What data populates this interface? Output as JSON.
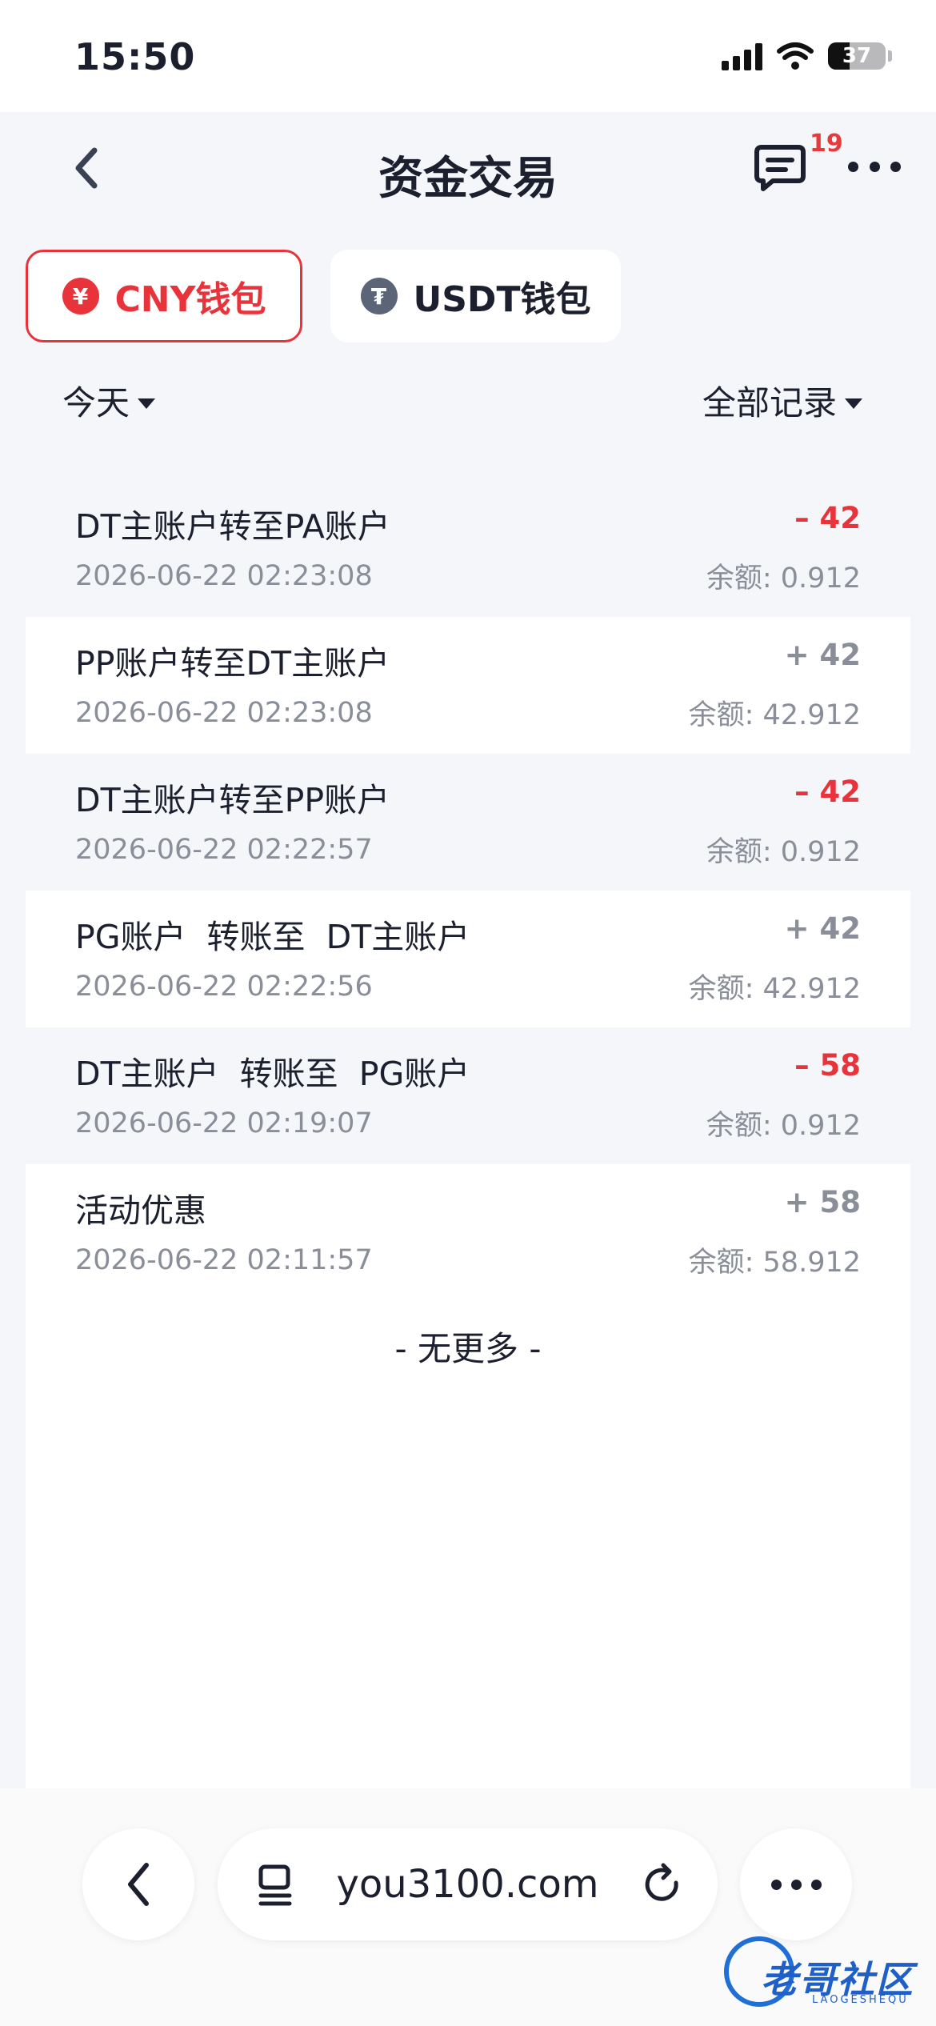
{
  "status_bar": {
    "time": "15:50",
    "battery": "37",
    "battery_level": 0.37
  },
  "nav": {
    "title": "资金交易",
    "message_badge": "19"
  },
  "wallet_tabs": [
    {
      "label": "CNY钱包",
      "coin": "¥",
      "active": true
    },
    {
      "label": "USDT钱包",
      "coin": "₮",
      "active": false
    }
  ],
  "filters": {
    "date": "今天",
    "type": "全部记录"
  },
  "transactions": [
    {
      "title": "DT主账户转至PA账户",
      "time": "2026-06-22 02:23:08",
      "amount": "– 42",
      "balance": "余额: 0.912",
      "direction": "neg"
    },
    {
      "title": "PP账户转至DT主账户",
      "time": "2026-06-22 02:23:08",
      "amount": "+ 42",
      "balance": "余额: 42.912",
      "direction": "pos"
    },
    {
      "title": "DT主账户转至PP账户",
      "time": "2026-06-22 02:22:57",
      "amount": "– 42",
      "balance": "余额: 0.912",
      "direction": "neg"
    },
    {
      "title": "PG账户  转账至  DT主账户",
      "time": "2026-06-22 02:22:56",
      "amount": "+ 42",
      "balance": "余额: 42.912",
      "direction": "pos"
    },
    {
      "title": "DT主账户  转账至  PG账户",
      "time": "2026-06-22 02:19:07",
      "amount": "– 58",
      "balance": "余额: 0.912",
      "direction": "neg"
    },
    {
      "title": "活动优惠",
      "time": "2026-06-22 02:11:57",
      "amount": "+ 58",
      "balance": "余额: 58.912",
      "direction": "pos"
    }
  ],
  "footer_text": "- 无更多 -",
  "browser": {
    "url": "you3100.com"
  },
  "watermark": {
    "text": "老哥社区",
    "sub": "LAOGESHEQU"
  },
  "colors": {
    "accent_red": "#e8333b",
    "muted": "#8a8e99",
    "text": "#1c1f2e"
  }
}
